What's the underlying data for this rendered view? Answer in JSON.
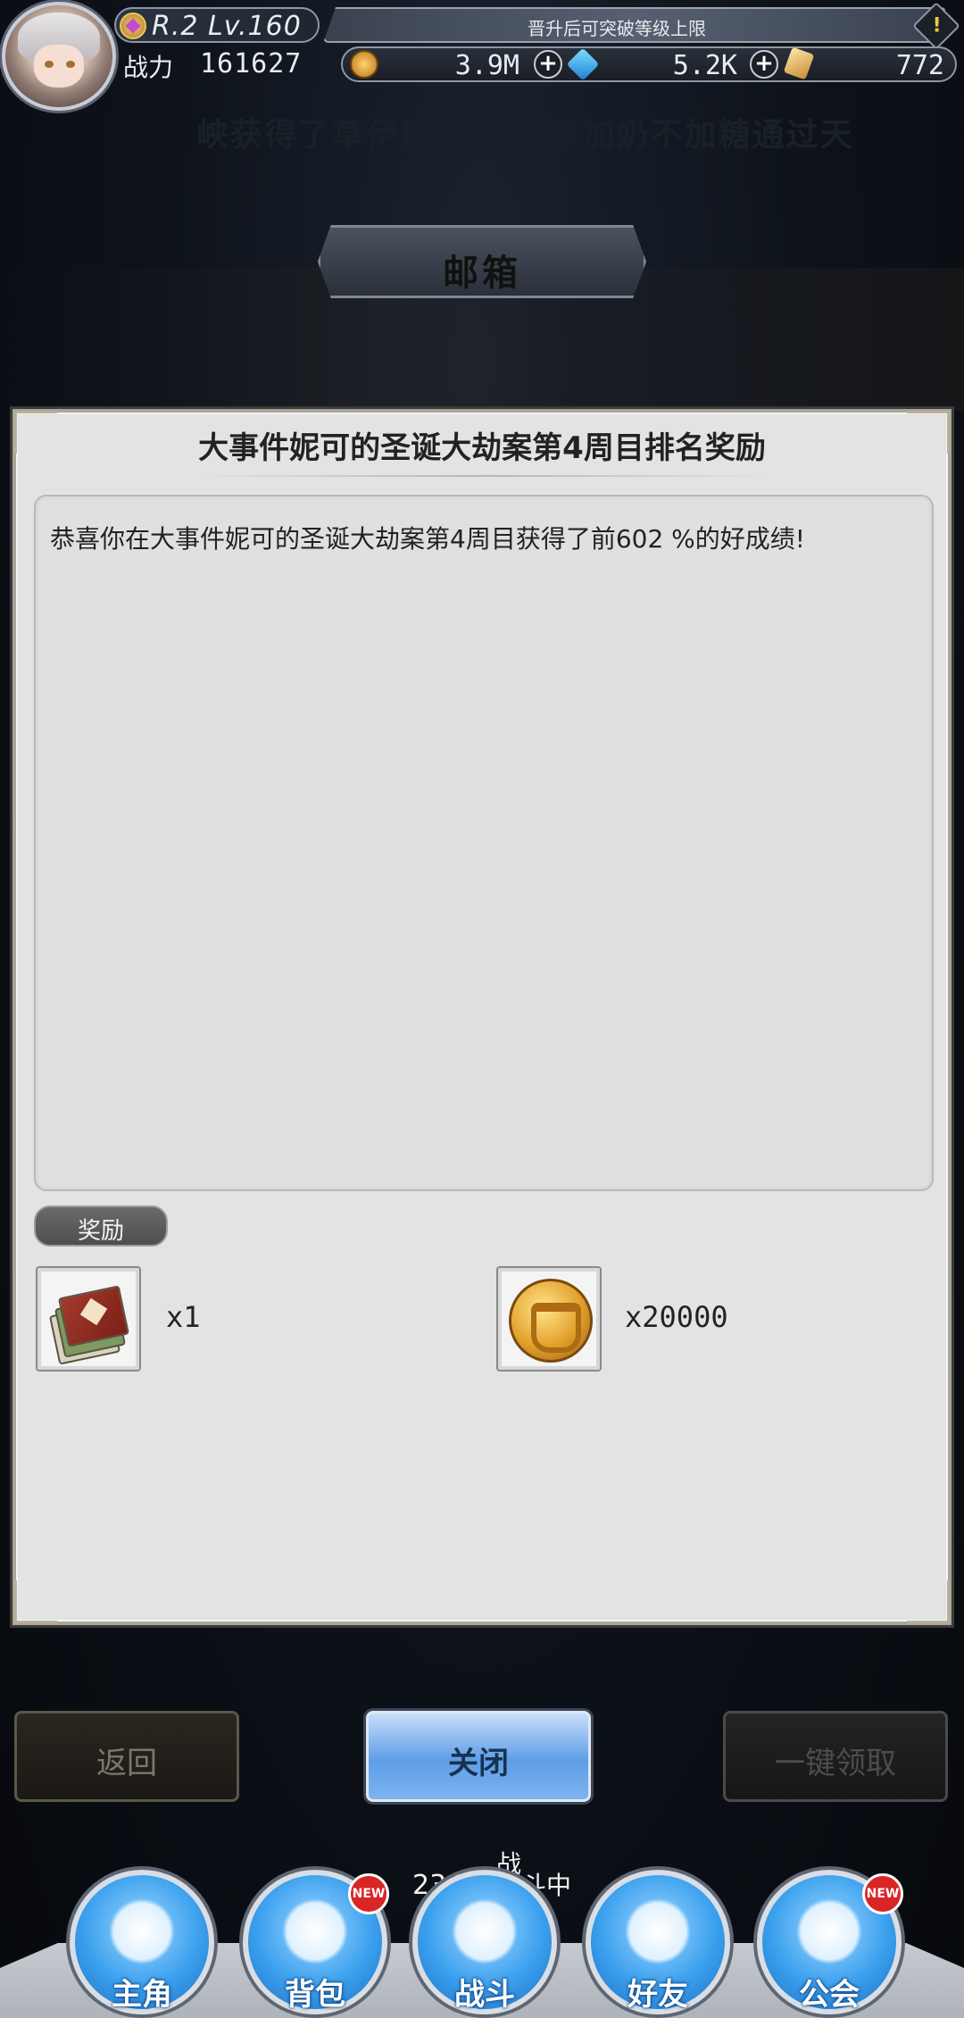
{
  "player": {
    "rank_level": "R.2 Lv.160",
    "power_label": "战力",
    "power_value": "161627"
  },
  "notice": {
    "text": "晋升后可突破等级上限"
  },
  "currencies": [
    {
      "name": "gold",
      "value": "3.9M",
      "icon": "coin-icon"
    },
    {
      "name": "diamond",
      "value": "5.2K",
      "icon": "diamond-icon"
    },
    {
      "name": "crystal",
      "value": "772",
      "icon": "crystal-icon"
    }
  ],
  "marquee": {
    "text": "峡获得了草伊拉    玩家红茶加奶不加糖通过天"
  },
  "screen": {
    "title": "邮箱"
  },
  "mail": {
    "title": "大事件妮可的圣诞大劫案第4周目排名奖励",
    "body": "恭喜你在大事件妮可的圣诞大劫案第4周目获得了前602 %的好成绩!",
    "reward_label": "奖励",
    "rewards": [
      {
        "icon": "card-pack-icon",
        "qty": "x1"
      },
      {
        "icon": "gold-coin-icon",
        "qty": "x20000"
      }
    ]
  },
  "buttons": {
    "back": "返回",
    "close": "关闭",
    "claim_all": "一键领取"
  },
  "battle": {
    "floor": "230层",
    "status_a": "战",
    "status_b": "斗中"
  },
  "nav": [
    {
      "label": "主角",
      "icon": "helmet-icon",
      "badge": ""
    },
    {
      "label": "背包",
      "icon": "backpack-icon",
      "badge": "NEW"
    },
    {
      "label": "战斗",
      "icon": "crossed-swords-icon",
      "badge": ""
    },
    {
      "label": "好友",
      "icon": "handshake-icon",
      "badge": ""
    },
    {
      "label": "公会",
      "icon": "guild-crest-icon",
      "badge": "NEW"
    }
  ],
  "colors": {
    "accent_blue": "#3ba0ee",
    "badge_red": "#d92525",
    "panel_bg": "#e3e3e3",
    "gold": "#e2a02c"
  }
}
